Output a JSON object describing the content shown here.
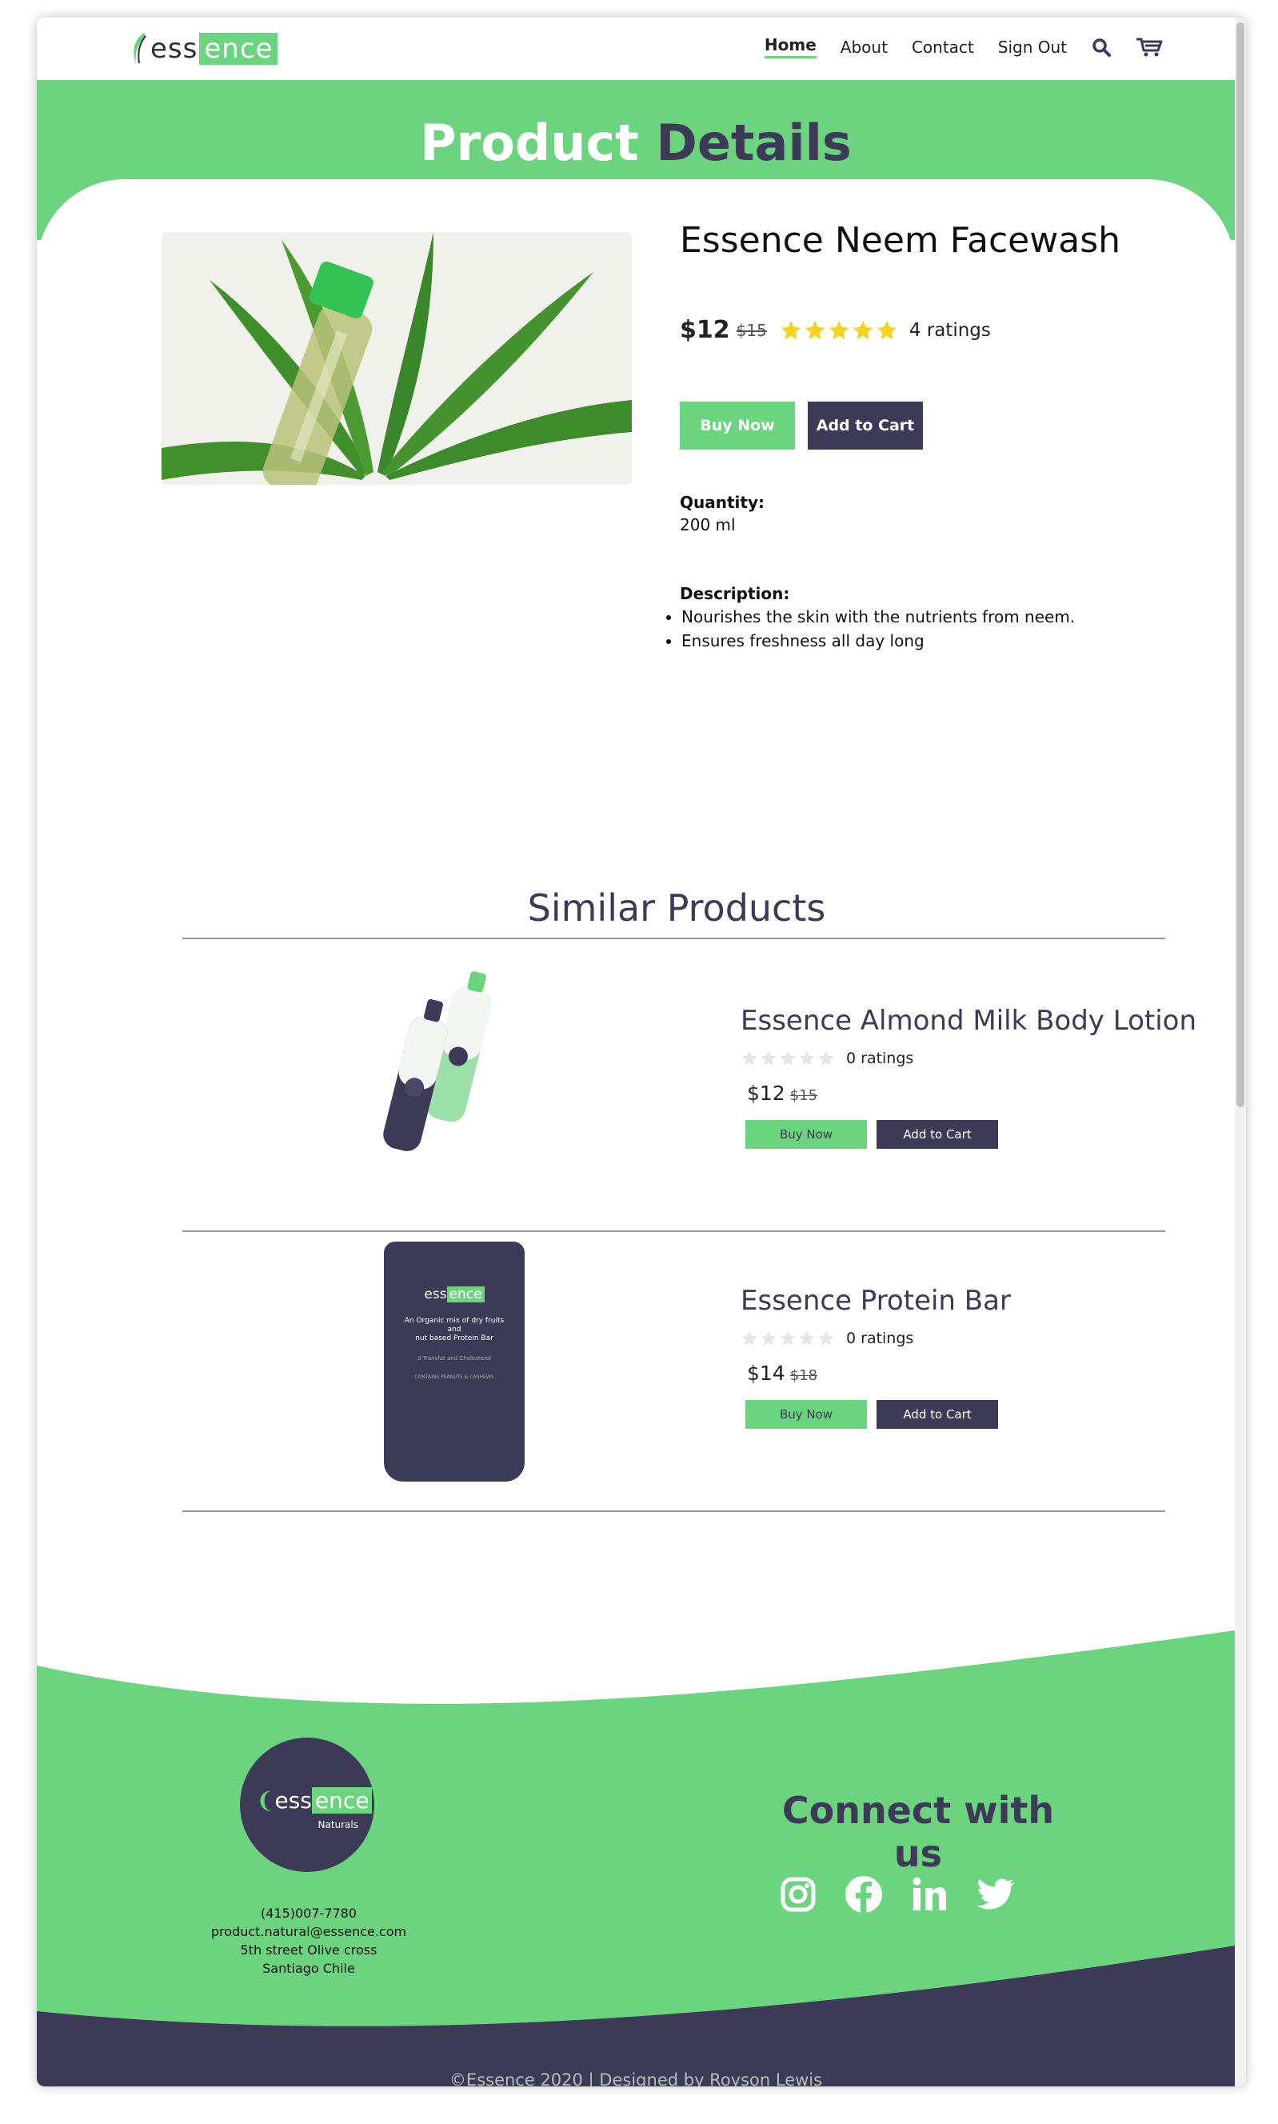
{
  "brand": {
    "logo_prefix": "ess",
    "logo_suffix": "ence",
    "footer_sub": "Naturals",
    "accent": "#6cd47e",
    "dark": "#3c3a56"
  },
  "nav": {
    "links": [
      "Home",
      "About",
      "Contact",
      "Sign Out"
    ],
    "active": "Home",
    "icons": [
      "search-icon",
      "cart-icon"
    ]
  },
  "hero": {
    "title_word1": "Product",
    "title_word2": "Details"
  },
  "product": {
    "name": "Essence Neem Facewash",
    "price": "$12",
    "old_price": "$15",
    "rating_stars": 5,
    "ratings_label": "4 ratings",
    "buy_label": "Buy Now",
    "cart_label": "Add to Cart",
    "quantity_label": "Quantity:",
    "quantity_value": "200 ml",
    "description_label": "Description:",
    "description": [
      "Nourishes the skin with the nutrients from neem.",
      "Ensures freshness all day long"
    ]
  },
  "similar": {
    "title": "Similar Products",
    "items": [
      {
        "name": "Essence Almond Milk Body Lotion",
        "ratings_label": "0 ratings",
        "price": "$12",
        "old_price": "$15",
        "buy_label": "Buy Now",
        "cart_label": "Add to Cart"
      },
      {
        "name": "Essence Protein Bar",
        "ratings_label": "0 ratings",
        "price": "$14",
        "old_price": "$18",
        "buy_label": "Buy Now",
        "cart_label": "Add to Cart",
        "pouch_lines": [
          "An Organic mix of dry fruits",
          "and",
          "nut based Protein Bar",
          "0 Transfat and Cholesterol",
          "CONTAINS PEANUTS & CASHEWS"
        ]
      }
    ]
  },
  "footer": {
    "contact": [
      "(415)007-7780",
      "product.natural@essence.com",
      "5th street Olive cross",
      "Santiago Chile"
    ],
    "connect_title": "Connect with us",
    "socials": [
      "instagram-icon",
      "facebook-icon",
      "linkedin-icon",
      "twitter-icon"
    ],
    "copyright": "©Essence 2020 | Designed by Royson Lewis"
  }
}
